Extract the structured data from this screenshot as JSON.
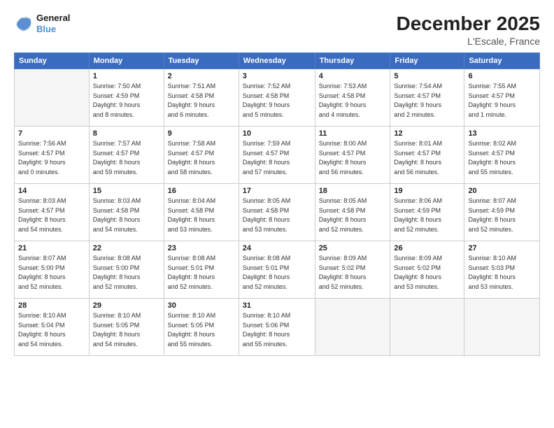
{
  "header": {
    "logo_line1": "General",
    "logo_line2": "Blue",
    "month_title": "December 2025",
    "subtitle": "L'Escale, France"
  },
  "weekdays": [
    "Sunday",
    "Monday",
    "Tuesday",
    "Wednesday",
    "Thursday",
    "Friday",
    "Saturday"
  ],
  "weeks": [
    [
      {
        "day": "",
        "info": ""
      },
      {
        "day": "1",
        "info": "Sunrise: 7:50 AM\nSunset: 4:59 PM\nDaylight: 9 hours\nand 8 minutes."
      },
      {
        "day": "2",
        "info": "Sunrise: 7:51 AM\nSunset: 4:58 PM\nDaylight: 9 hours\nand 6 minutes."
      },
      {
        "day": "3",
        "info": "Sunrise: 7:52 AM\nSunset: 4:58 PM\nDaylight: 9 hours\nand 5 minutes."
      },
      {
        "day": "4",
        "info": "Sunrise: 7:53 AM\nSunset: 4:58 PM\nDaylight: 9 hours\nand 4 minutes."
      },
      {
        "day": "5",
        "info": "Sunrise: 7:54 AM\nSunset: 4:57 PM\nDaylight: 9 hours\nand 2 minutes."
      },
      {
        "day": "6",
        "info": "Sunrise: 7:55 AM\nSunset: 4:57 PM\nDaylight: 9 hours\nand 1 minute."
      }
    ],
    [
      {
        "day": "7",
        "info": "Sunrise: 7:56 AM\nSunset: 4:57 PM\nDaylight: 9 hours\nand 0 minutes."
      },
      {
        "day": "8",
        "info": "Sunrise: 7:57 AM\nSunset: 4:57 PM\nDaylight: 8 hours\nand 59 minutes."
      },
      {
        "day": "9",
        "info": "Sunrise: 7:58 AM\nSunset: 4:57 PM\nDaylight: 8 hours\nand 58 minutes."
      },
      {
        "day": "10",
        "info": "Sunrise: 7:59 AM\nSunset: 4:57 PM\nDaylight: 8 hours\nand 57 minutes."
      },
      {
        "day": "11",
        "info": "Sunrise: 8:00 AM\nSunset: 4:57 PM\nDaylight: 8 hours\nand 56 minutes."
      },
      {
        "day": "12",
        "info": "Sunrise: 8:01 AM\nSunset: 4:57 PM\nDaylight: 8 hours\nand 56 minutes."
      },
      {
        "day": "13",
        "info": "Sunrise: 8:02 AM\nSunset: 4:57 PM\nDaylight: 8 hours\nand 55 minutes."
      }
    ],
    [
      {
        "day": "14",
        "info": "Sunrise: 8:03 AM\nSunset: 4:57 PM\nDaylight: 8 hours\nand 54 minutes."
      },
      {
        "day": "15",
        "info": "Sunrise: 8:03 AM\nSunset: 4:58 PM\nDaylight: 8 hours\nand 54 minutes."
      },
      {
        "day": "16",
        "info": "Sunrise: 8:04 AM\nSunset: 4:58 PM\nDaylight: 8 hours\nand 53 minutes."
      },
      {
        "day": "17",
        "info": "Sunrise: 8:05 AM\nSunset: 4:58 PM\nDaylight: 8 hours\nand 53 minutes."
      },
      {
        "day": "18",
        "info": "Sunrise: 8:05 AM\nSunset: 4:58 PM\nDaylight: 8 hours\nand 52 minutes."
      },
      {
        "day": "19",
        "info": "Sunrise: 8:06 AM\nSunset: 4:59 PM\nDaylight: 8 hours\nand 52 minutes."
      },
      {
        "day": "20",
        "info": "Sunrise: 8:07 AM\nSunset: 4:59 PM\nDaylight: 8 hours\nand 52 minutes."
      }
    ],
    [
      {
        "day": "21",
        "info": "Sunrise: 8:07 AM\nSunset: 5:00 PM\nDaylight: 8 hours\nand 52 minutes."
      },
      {
        "day": "22",
        "info": "Sunrise: 8:08 AM\nSunset: 5:00 PM\nDaylight: 8 hours\nand 52 minutes."
      },
      {
        "day": "23",
        "info": "Sunrise: 8:08 AM\nSunset: 5:01 PM\nDaylight: 8 hours\nand 52 minutes."
      },
      {
        "day": "24",
        "info": "Sunrise: 8:08 AM\nSunset: 5:01 PM\nDaylight: 8 hours\nand 52 minutes."
      },
      {
        "day": "25",
        "info": "Sunrise: 8:09 AM\nSunset: 5:02 PM\nDaylight: 8 hours\nand 52 minutes."
      },
      {
        "day": "26",
        "info": "Sunrise: 8:09 AM\nSunset: 5:02 PM\nDaylight: 8 hours\nand 53 minutes."
      },
      {
        "day": "27",
        "info": "Sunrise: 8:10 AM\nSunset: 5:03 PM\nDaylight: 8 hours\nand 53 minutes."
      }
    ],
    [
      {
        "day": "28",
        "info": "Sunrise: 8:10 AM\nSunset: 5:04 PM\nDaylight: 8 hours\nand 54 minutes."
      },
      {
        "day": "29",
        "info": "Sunrise: 8:10 AM\nSunset: 5:05 PM\nDaylight: 8 hours\nand 54 minutes."
      },
      {
        "day": "30",
        "info": "Sunrise: 8:10 AM\nSunset: 5:05 PM\nDaylight: 8 hours\nand 55 minutes."
      },
      {
        "day": "31",
        "info": "Sunrise: 8:10 AM\nSunset: 5:06 PM\nDaylight: 8 hours\nand 55 minutes."
      },
      {
        "day": "",
        "info": ""
      },
      {
        "day": "",
        "info": ""
      },
      {
        "day": "",
        "info": ""
      }
    ]
  ]
}
